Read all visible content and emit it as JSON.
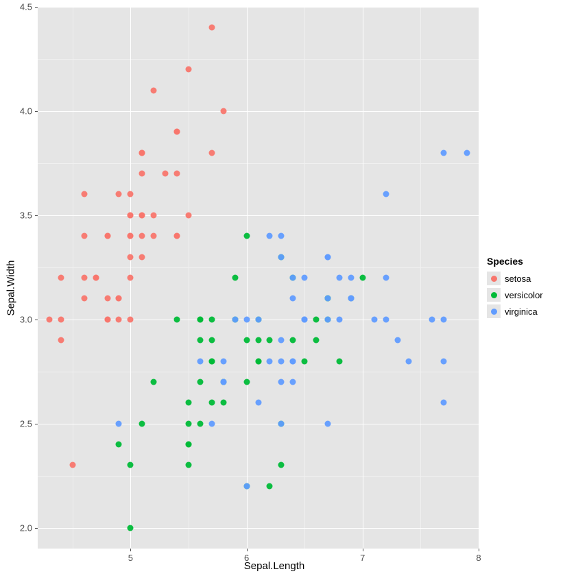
{
  "chart_data": {
    "type": "scatter",
    "xlabel": "Sepal.Length",
    "ylabel": "Sepal.Width",
    "title": "",
    "xlim": [
      4.2,
      8.0
    ],
    "ylim": [
      1.9,
      4.5
    ],
    "x_ticks": [
      5,
      6,
      7,
      8
    ],
    "y_ticks": [
      2.0,
      2.5,
      3.0,
      3.5,
      4.0,
      4.5
    ],
    "x_minor": [
      4.5,
      5.5,
      6.5,
      7.5
    ],
    "y_minor": [
      2.25,
      2.75,
      3.25,
      3.75,
      4.25
    ],
    "legend_title": "Species",
    "colors": {
      "setosa": "#F8766D",
      "versicolor": "#00BA38",
      "virginica": "#619CFF"
    },
    "series": [
      {
        "name": "setosa",
        "points": [
          [
            5.1,
            3.5
          ],
          [
            4.9,
            3.0
          ],
          [
            4.7,
            3.2
          ],
          [
            4.6,
            3.1
          ],
          [
            5.0,
            3.6
          ],
          [
            5.4,
            3.9
          ],
          [
            4.6,
            3.4
          ],
          [
            5.0,
            3.4
          ],
          [
            4.4,
            2.9
          ],
          [
            4.9,
            3.1
          ],
          [
            5.4,
            3.7
          ],
          [
            4.8,
            3.4
          ],
          [
            4.8,
            3.0
          ],
          [
            4.3,
            3.0
          ],
          [
            5.8,
            4.0
          ],
          [
            5.7,
            4.4
          ],
          [
            5.4,
            3.9
          ],
          [
            5.1,
            3.5
          ],
          [
            5.7,
            3.8
          ],
          [
            5.1,
            3.8
          ],
          [
            5.4,
            3.4
          ],
          [
            5.1,
            3.7
          ],
          [
            4.6,
            3.6
          ],
          [
            5.1,
            3.3
          ],
          [
            4.8,
            3.4
          ],
          [
            5.0,
            3.0
          ],
          [
            5.0,
            3.4
          ],
          [
            5.2,
            3.5
          ],
          [
            5.2,
            3.4
          ],
          [
            4.7,
            3.2
          ],
          [
            4.8,
            3.1
          ],
          [
            5.4,
            3.4
          ],
          [
            5.2,
            4.1
          ],
          [
            5.5,
            4.2
          ],
          [
            4.9,
            3.1
          ],
          [
            5.0,
            3.2
          ],
          [
            5.5,
            3.5
          ],
          [
            4.9,
            3.6
          ],
          [
            4.4,
            3.0
          ],
          [
            5.1,
            3.4
          ],
          [
            5.0,
            3.5
          ],
          [
            4.5,
            2.3
          ],
          [
            4.4,
            3.2
          ],
          [
            5.0,
            3.5
          ],
          [
            5.1,
            3.8
          ],
          [
            4.8,
            3.0
          ],
          [
            5.1,
            3.8
          ],
          [
            4.6,
            3.2
          ],
          [
            5.3,
            3.7
          ],
          [
            5.0,
            3.3
          ]
        ]
      },
      {
        "name": "versicolor",
        "points": [
          [
            7.0,
            3.2
          ],
          [
            6.4,
            3.2
          ],
          [
            6.9,
            3.1
          ],
          [
            5.5,
            2.3
          ],
          [
            6.5,
            2.8
          ],
          [
            5.7,
            2.8
          ],
          [
            6.3,
            3.3
          ],
          [
            4.9,
            2.4
          ],
          [
            6.6,
            2.9
          ],
          [
            5.2,
            2.7
          ],
          [
            5.0,
            2.0
          ],
          [
            5.9,
            3.0
          ],
          [
            6.0,
            2.2
          ],
          [
            6.1,
            2.9
          ],
          [
            5.6,
            2.9
          ],
          [
            6.7,
            3.1
          ],
          [
            5.6,
            3.0
          ],
          [
            5.8,
            2.7
          ],
          [
            6.2,
            2.2
          ],
          [
            5.6,
            2.5
          ],
          [
            5.9,
            3.2
          ],
          [
            6.1,
            2.8
          ],
          [
            6.3,
            2.5
          ],
          [
            6.1,
            2.8
          ],
          [
            6.4,
            2.9
          ],
          [
            6.6,
            3.0
          ],
          [
            6.8,
            2.8
          ],
          [
            6.7,
            3.0
          ],
          [
            6.0,
            2.9
          ],
          [
            5.7,
            2.6
          ],
          [
            5.5,
            2.4
          ],
          [
            5.5,
            2.4
          ],
          [
            5.8,
            2.7
          ],
          [
            6.0,
            2.7
          ],
          [
            5.4,
            3.0
          ],
          [
            6.0,
            3.4
          ],
          [
            6.7,
            3.1
          ],
          [
            6.3,
            2.3
          ],
          [
            5.6,
            3.0
          ],
          [
            5.5,
            2.5
          ],
          [
            5.5,
            2.6
          ],
          [
            6.1,
            3.0
          ],
          [
            5.8,
            2.6
          ],
          [
            5.0,
            2.3
          ],
          [
            5.6,
            2.7
          ],
          [
            5.7,
            3.0
          ],
          [
            5.7,
            2.9
          ],
          [
            6.2,
            2.9
          ],
          [
            5.1,
            2.5
          ],
          [
            5.7,
            2.8
          ]
        ]
      },
      {
        "name": "virginica",
        "points": [
          [
            6.3,
            3.3
          ],
          [
            5.8,
            2.7
          ],
          [
            7.1,
            3.0
          ],
          [
            6.3,
            2.9
          ],
          [
            6.5,
            3.0
          ],
          [
            7.6,
            3.0
          ],
          [
            4.9,
            2.5
          ],
          [
            7.3,
            2.9
          ],
          [
            6.7,
            2.5
          ],
          [
            7.2,
            3.6
          ],
          [
            6.5,
            3.2
          ],
          [
            6.4,
            2.7
          ],
          [
            6.8,
            3.0
          ],
          [
            5.7,
            2.5
          ],
          [
            5.8,
            2.8
          ],
          [
            6.4,
            3.2
          ],
          [
            6.5,
            3.0
          ],
          [
            7.7,
            3.8
          ],
          [
            7.7,
            2.6
          ],
          [
            6.0,
            2.2
          ],
          [
            6.9,
            3.2
          ],
          [
            5.6,
            2.8
          ],
          [
            7.7,
            2.8
          ],
          [
            6.3,
            2.7
          ],
          [
            6.7,
            3.3
          ],
          [
            7.2,
            3.2
          ],
          [
            6.2,
            2.8
          ],
          [
            6.1,
            3.0
          ],
          [
            6.4,
            2.8
          ],
          [
            7.2,
            3.0
          ],
          [
            7.4,
            2.8
          ],
          [
            7.9,
            3.8
          ],
          [
            6.4,
            2.8
          ],
          [
            6.3,
            2.8
          ],
          [
            6.1,
            2.6
          ],
          [
            7.7,
            3.0
          ],
          [
            6.3,
            3.4
          ],
          [
            6.4,
            3.1
          ],
          [
            6.0,
            3.0
          ],
          [
            6.9,
            3.1
          ],
          [
            6.7,
            3.1
          ],
          [
            6.9,
            3.1
          ],
          [
            5.8,
            2.7
          ],
          [
            6.8,
            3.2
          ],
          [
            6.7,
            3.3
          ],
          [
            6.7,
            3.0
          ],
          [
            6.3,
            2.5
          ],
          [
            6.5,
            3.0
          ],
          [
            6.2,
            3.4
          ],
          [
            5.9,
            3.0
          ]
        ]
      }
    ]
  }
}
